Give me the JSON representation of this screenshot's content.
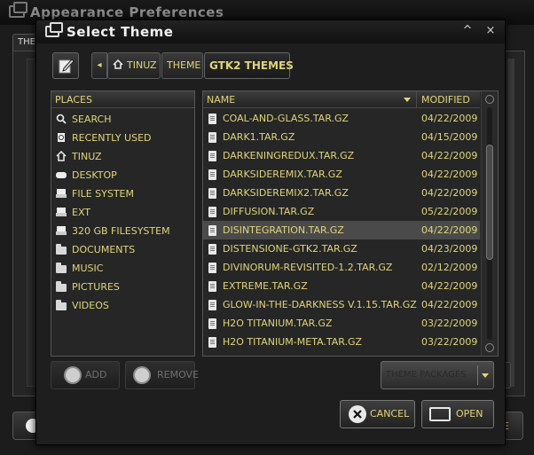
{
  "background_window": {
    "title": "Appearance Preferences",
    "tab_label": "THEME",
    "right_button_label": "E"
  },
  "dialog": {
    "title": "Select Theme",
    "controls": {
      "minimize": "^",
      "close": "×"
    }
  },
  "pathbar": {
    "crumbs": [
      "TINUZ",
      "THEME",
      "GTK2 THEMES"
    ],
    "left_arrow": "◂"
  },
  "places": {
    "header": "PLACES",
    "items": [
      {
        "label": "SEARCH",
        "icon": "search-icon"
      },
      {
        "label": "RECENTLY USED",
        "icon": "recent-icon"
      },
      {
        "label": "TINUZ",
        "icon": "home-icon"
      },
      {
        "label": "DESKTOP",
        "icon": "desktop-icon"
      },
      {
        "label": "FILE SYSTEM",
        "icon": "drive-icon"
      },
      {
        "label": "EXT",
        "icon": "drive-icon"
      },
      {
        "label": "320 GB FILESYSTEM",
        "icon": "drive-icon"
      },
      {
        "label": "DOCUMENTS",
        "icon": "folder-icon"
      },
      {
        "label": "MUSIC",
        "icon": "folder-icon"
      },
      {
        "label": "PICTURES",
        "icon": "folder-icon"
      },
      {
        "label": "VIDEOS",
        "icon": "folder-icon"
      }
    ],
    "add_label": "ADD",
    "remove_label": "REMOVE"
  },
  "files": {
    "columns": {
      "name": "NAME",
      "modified": "MODIFIED"
    },
    "rows": [
      {
        "name": "COAL-AND-GLASS.TAR.GZ",
        "modified": "04/22/2009"
      },
      {
        "name": "DARK1.TAR.GZ",
        "modified": "04/15/2009"
      },
      {
        "name": "DARKENINGREDUX.TAR.GZ",
        "modified": "04/22/2009"
      },
      {
        "name": "DARKSIDEREMIX.TAR.GZ",
        "modified": "04/22/2009"
      },
      {
        "name": "DARKSIDEREMIX2.TAR.GZ",
        "modified": "04/22/2009"
      },
      {
        "name": "DIFFUSION.TAR.GZ",
        "modified": "05/22/2009"
      },
      {
        "name": "DISINTEGRATION.TAR.GZ",
        "modified": "04/22/2009",
        "selected": true
      },
      {
        "name": "DISTENSIONE-GTK2.TAR.GZ",
        "modified": "04/23/2009"
      },
      {
        "name": "DIVINORUM-REVISITED-1.2.TAR.GZ",
        "modified": "02/12/2009"
      },
      {
        "name": "EXTREME.TAR.GZ",
        "modified": "04/22/2009"
      },
      {
        "name": "GLOW-IN-THE-DARKNESS V.1.15.TAR.GZ",
        "modified": "04/22/2009"
      },
      {
        "name": "H2O TITANIUM.TAR.GZ",
        "modified": "03/22/2009"
      },
      {
        "name": "H2O TITANIUM-META.TAR.GZ",
        "modified": "03/22/2009"
      }
    ]
  },
  "filter": {
    "selected": "THEME PACKAGES"
  },
  "actions": {
    "cancel_label": "CANCEL",
    "open_label": "OPEN"
  },
  "colors": {
    "text_accent": "#e0d47a",
    "background": "#1e1e1e",
    "selection": "#4a4a4a"
  }
}
